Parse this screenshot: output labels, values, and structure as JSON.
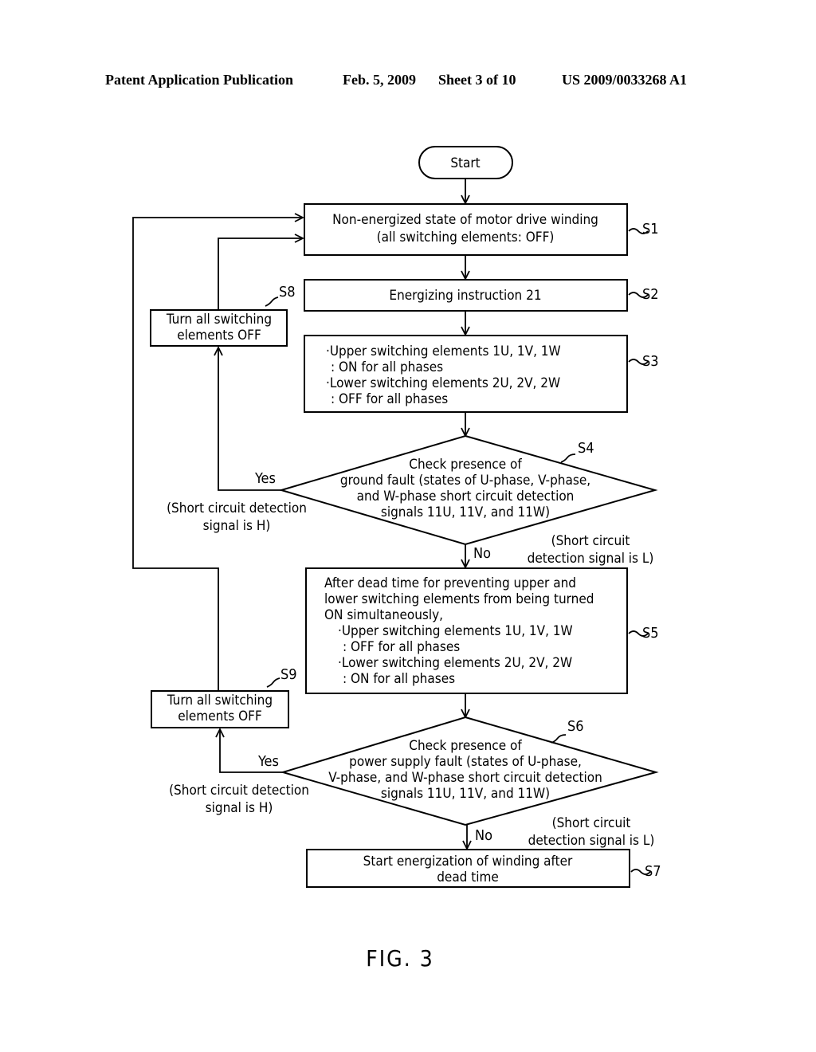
{
  "header": {
    "publication": "Patent Application Publication",
    "date": "Feb. 5, 2009",
    "sheet": "Sheet 3 of 10",
    "number": "US 2009/0033268 A1"
  },
  "flowchart": {
    "start": "Start",
    "s1": {
      "id": "S1",
      "lines": [
        "Non-energized state of motor drive winding",
        "(all switching elements: OFF)"
      ]
    },
    "s2": {
      "id": "S2",
      "lines": [
        "Energizing instruction 21"
      ]
    },
    "s3": {
      "id": "S3",
      "lines": [
        "·Upper switching elements 1U, 1V, 1W",
        " : ON for all phases",
        "·Lower switching elements 2U, 2V, 2W",
        " : OFF for all phases"
      ]
    },
    "s4": {
      "id": "S4",
      "lines": [
        "Check presence of",
        "ground fault (states of U-phase, V-phase,",
        "and W-phase short circuit detection",
        "signals 11U, 11V, and 11W)"
      ]
    },
    "s4_yes": {
      "label": "Yes",
      "note": [
        "(Short circuit detection",
        "signal is H)"
      ]
    },
    "s4_no": {
      "label": "No",
      "note": [
        "(Short circuit",
        "detection signal is L)"
      ]
    },
    "s5": {
      "id": "S5",
      "lines": [
        "After dead time for preventing upper and",
        "lower switching elements from being turned",
        "ON simultaneously,",
        "·Upper switching elements 1U, 1V, 1W",
        " : OFF for all phases",
        "·Lower switching elements 2U, 2V, 2W",
        " : ON for all phases"
      ]
    },
    "s6": {
      "id": "S6",
      "lines": [
        "Check presence of",
        "power supply fault (states of U-phase,",
        "V-phase, and W-phase short circuit detection",
        "signals 11U, 11V, and 11W)"
      ]
    },
    "s6_yes": {
      "label": "Yes",
      "note": [
        "(Short circuit detection",
        "signal is H)"
      ]
    },
    "s6_no": {
      "label": "No",
      "note": [
        "(Short circuit",
        "detection signal is L)"
      ]
    },
    "s7": {
      "id": "S7",
      "lines": [
        "Start energization of winding after",
        "dead time"
      ]
    },
    "s8": {
      "id": "S8",
      "lines": [
        "Turn all switching",
        "elements OFF"
      ]
    },
    "s9": {
      "id": "S9",
      "lines": [
        "Turn all switching",
        "elements OFF"
      ]
    }
  },
  "figure_label": "FIG. 3"
}
